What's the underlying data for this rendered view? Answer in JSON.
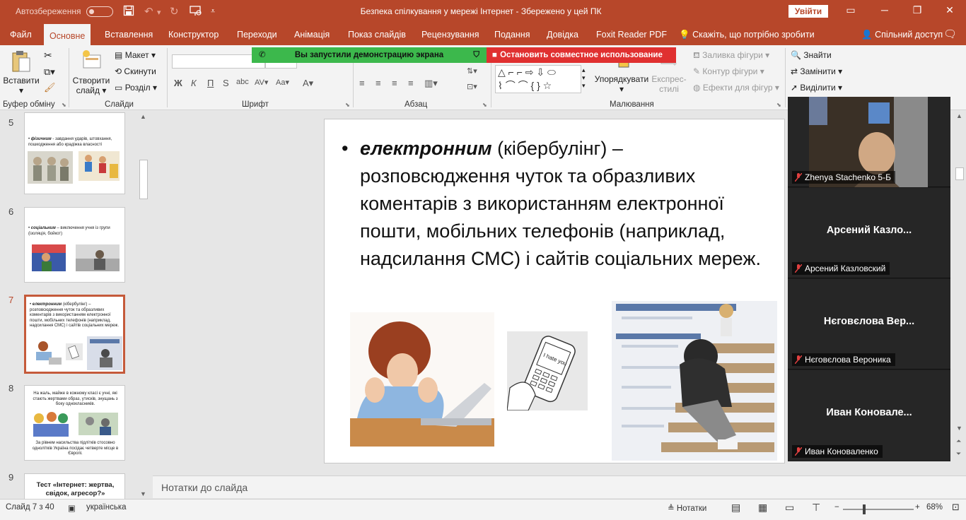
{
  "titlebar": {
    "autosave_label": "Автозбереження",
    "document_title": "Безпека спілкування у мережі Інтернет  -  Збережено у цей ПК",
    "signin_label": "Увійти"
  },
  "tabs": [
    "Файл",
    "Основне",
    "Вставлення",
    "Конструктор",
    "Переходи",
    "Анімація",
    "Показ слайдів",
    "Рецензування",
    "Подання",
    "Довідка",
    "Foxit Reader PDF",
    "Скажіть, що потрібно зробити",
    "Спільний доступ"
  ],
  "ribbon": {
    "paste_label": "Вставити",
    "clipboard_group": "Буфер обміну",
    "new_slide_label": "Створити слайд",
    "layout_label": "Макет",
    "reset_label": "Скинути",
    "section_label": "Розділ",
    "slides_group": "Слайди",
    "font_group": "Шрифт",
    "paragraph_group": "Абзац",
    "arrange_label": "Упорядкувати",
    "quick_styles_label": "Експрес-стилі",
    "shape_fill_label": "Заливка фігури",
    "shape_outline_label": "Контур фігури",
    "shape_effects_label": "Ефекти для фігур",
    "drawing_group": "Малювання",
    "find_label": "Знайти",
    "replace_label": "Замінити",
    "select_label": "Виділити"
  },
  "share": {
    "green_text": "Вы запустили демонстрацию экрана",
    "red_text": "Остановить совместное использование"
  },
  "thumbnails": [
    {
      "num": "5",
      "text_bold": "фізичним",
      "text": " - завдання ударів, штовхання, пошкодження або крадіжка власності"
    },
    {
      "num": "6",
      "text_bold": "соціальним",
      "text": " – виключення учня із групи (ізоляція, бойкот)"
    },
    {
      "num": "7",
      "text_bold": "електронним",
      "text": " (кібербулінг) – розповсюдження чуток та образливих коментарів з використанням електронної пошти, мобільних телефонів (наприклад, надсилання СМС) і сайтів соціальних мереж."
    },
    {
      "num": "8",
      "text": "На жаль, майже в кожному класі є учні, які стають жертвами образ, утисків, знущань з боку однокласників.",
      "text2": "За рівнем насильства підлітків стосовно однолітків Україна посідає четверте місце в Європі."
    },
    {
      "num": "9",
      "text": "Тест «Інтернет: жертва, свідок, агресор?»"
    }
  ],
  "slide": {
    "bold_italic": "електронним",
    "rest": " (кібербулінг) – розповсюдження чуток та образливих коментарів з використанням електронної пошти, мобільних телефонів (наприклад, надсилання СМС) і сайтів соціальних мереж."
  },
  "phone_text": "I hate you",
  "notes_placeholder": "Нотатки до слайда",
  "status": {
    "slide_info": "Слайд 7 з 40",
    "language": "українська",
    "notes_label": "Нотатки",
    "zoom": "68%"
  },
  "participants": [
    {
      "label": "Zhenya Stachenko 5-Б",
      "big": ""
    },
    {
      "label": "Арсений Казловский",
      "big": "Арсений  Казло..."
    },
    {
      "label": "Нєговєлова Вероника",
      "big": "Нєговєлова Вер..."
    },
    {
      "label": "Иван Коноваленко",
      "big": "Иван  Коновале..."
    }
  ],
  "colors": {
    "accent": "#b7472a",
    "share_green": "#3cb84c",
    "share_red": "#e03030"
  }
}
